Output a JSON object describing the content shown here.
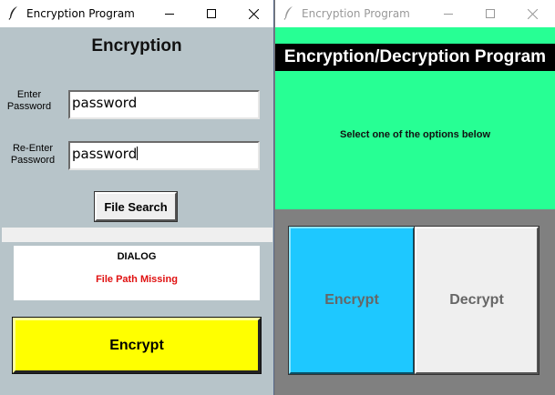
{
  "left_window": {
    "title": "Encryption Program",
    "heading": "Encryption",
    "password_label": "Enter\nPassword",
    "password_value": "password",
    "reenter_label": "Re-Enter\nPassword",
    "reenter_value": "password",
    "file_search_label": "File Search",
    "dialog_title": "DIALOG",
    "dialog_message": "File Path Missing",
    "encrypt_label": "Encrypt"
  },
  "right_window": {
    "title": "Encryption Program",
    "banner": "Encryption/Decryption Program",
    "subtitle": "Select one of the options below",
    "encrypt_label": "Encrypt",
    "decrypt_label": "Decrypt"
  },
  "colors": {
    "left_background": "#b7c4c9",
    "green_panel": "#27ff94",
    "encrypt_yellow": "#ffff00",
    "encrypt_blue": "#1ec8ff",
    "error_red": "#e01010"
  },
  "icons": {
    "app": "feather-icon",
    "minimize": "minimize-icon",
    "maximize": "maximize-icon",
    "close": "close-icon"
  }
}
